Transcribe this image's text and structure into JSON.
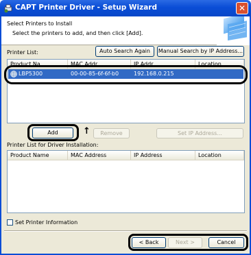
{
  "window": {
    "title": "CAPT Printer Driver - Setup Wizard",
    "close_glyph": "✕"
  },
  "header": {
    "title": "Select Printers to Install",
    "subtitle": "Select the printers to add, and then click [Add]."
  },
  "printer_list": {
    "label": "Printer List:",
    "auto_search_label": "Auto Search Again",
    "manual_search_label": "Manual Search by IP Address...",
    "columns": [
      "Product Na",
      "MAC Addr",
      "IP Addr",
      "Location"
    ],
    "rows": [
      {
        "name": "LBP5300",
        "mac": "00-00-85-6f-6f-b0",
        "ip": "192.168.0.215",
        "location": ""
      }
    ]
  },
  "actions": {
    "add_label": "Add",
    "arrow_glyph": "↑",
    "remove_label": "Remove",
    "set_ip_label": "Set IP Address..."
  },
  "install_list": {
    "label": "Printer List for Driver Installation:",
    "columns": [
      "Product Name",
      "MAC Address",
      "IP Address",
      "Location"
    ]
  },
  "options": {
    "set_printer_info_label": "Set Printer Information"
  },
  "footer": {
    "back_label": "< Back",
    "next_label": "Next >",
    "cancel_label": "Cancel"
  },
  "colors": {
    "title_bar": "#0a4dd6",
    "selection": "#316ac5",
    "window_bg": "#ece9d8"
  }
}
